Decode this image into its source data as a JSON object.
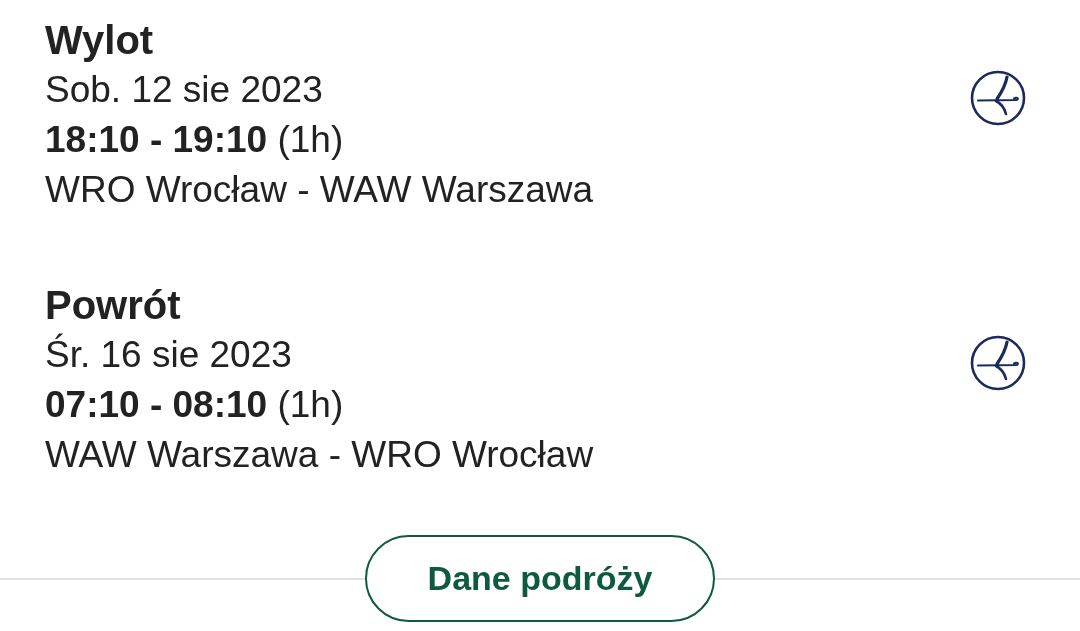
{
  "flights": [
    {
      "title": "Wylot",
      "date": "Sob. 12 sie 2023",
      "time": "**18:10 - 19:10** (1h)",
      "route": "WRO Wrocław - WAW Warszawa"
    },
    {
      "title": "Powrót",
      "date": "Śr. 16 sie 2023",
      "time": "**07:10 - 08:10** (1h)",
      "route": "WAW Warszawa - WRO Wrocław"
    }
  ],
  "button": {
    "label": "Dane podróży"
  }
}
